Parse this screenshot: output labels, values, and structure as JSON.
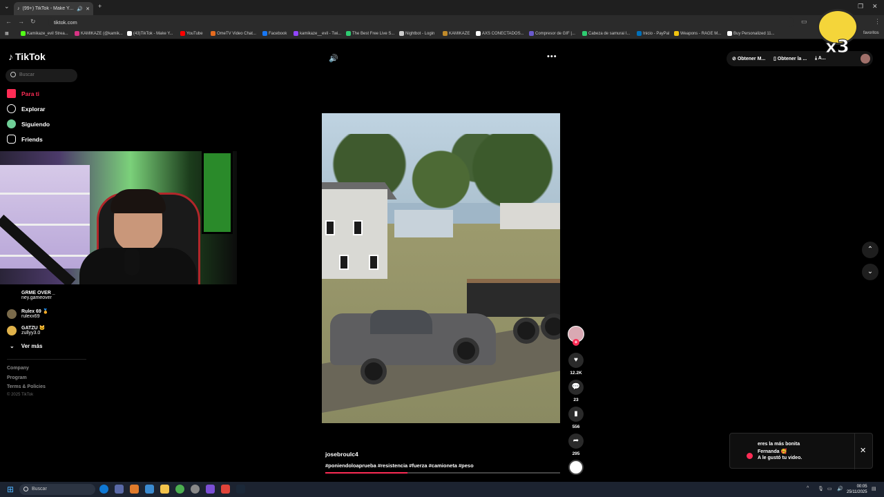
{
  "browser": {
    "tab_title": "(99+) TikTok - Make Your D...",
    "url": "tiktok.com",
    "bookmarks": [
      "Kamikaze_evil Strea...",
      "KAMIKAZE (@kamik...",
      "(43)TikTok - Make Y...",
      "YouTube",
      "OmeTV Video Chat...",
      "Facebook",
      "kamikaze__evil - Twi...",
      "The Best Free Live S...",
      "Nightbot - Login",
      "KAMIKAZE",
      "AXS CONECTADOS...",
      "Compresor de GIF |...",
      "Cabeza de samurai I...",
      "Inicio - PayPal",
      "Weapons - RAGE M...",
      "Buy Personalized 11..."
    ],
    "favorites_label": "favoritos"
  },
  "sidebar": {
    "logo": "TikTok",
    "search_placeholder": "Buscar",
    "nav": [
      {
        "label": "Para ti",
        "active": true,
        "icon": "home-icon"
      },
      {
        "label": "Explorar",
        "active": false,
        "icon": "compass-icon"
      },
      {
        "label": "Siguiendo",
        "active": false,
        "icon": "following-icon"
      },
      {
        "label": "Friends",
        "active": false,
        "icon": "friends-icon"
      }
    ],
    "following": [
      {
        "name": "GRME OVER _",
        "handle": "ney.gameover"
      },
      {
        "name": "Rulex 69 🏅",
        "handle": "rulexx69"
      },
      {
        "name": "GATZU 🐱",
        "handle": "zullyy3.0"
      }
    ],
    "ver_mas": "Ver más",
    "footer": [
      "Company",
      "Program",
      "Terms & Policies"
    ],
    "copyright": "© 2025 TikTok"
  },
  "video": {
    "username": "josebroulc4",
    "hashtags": "#poniendoloaprueba #resistencia #fuerza #camioneta #peso",
    "progress": 0.35,
    "likes": "12.2K",
    "comments": "23",
    "saves": "556",
    "shares": "295"
  },
  "topright": {
    "item1": "Obtener M...",
    "item2": "Obtener la ...",
    "item3": "A..."
  },
  "overlay": {
    "badge": "x3"
  },
  "notification": {
    "line1": "eres la más bonita",
    "line2": "Fernanda 🥰",
    "line3": "A le gustó tu video."
  },
  "taskbar": {
    "search": "Buscar",
    "time": "00:05",
    "date": "25/11/2025"
  },
  "colors": {
    "accent": "#fe2c55",
    "bg": "#000000"
  }
}
